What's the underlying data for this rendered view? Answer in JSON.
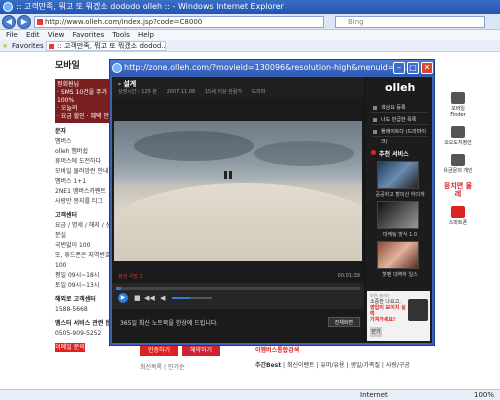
{
  "ie": {
    "title": ":: 고객만족, 뭐고 또 뭐겠소 dododo olleh :: - Windows Internet Explorer",
    "address": "http://www.olleh.com/index.jsp?code=C8000",
    "search_placeholder": "Bing",
    "menu": [
      "File",
      "Edit",
      "View",
      "Favorites",
      "Tools",
      "Help"
    ],
    "favorites_label": "Favorites",
    "tab_label": ":: 고객만족, 뭐고 또 뭐겠소 dodod...",
    "status_zone": "Internet",
    "status_zoom": "100%"
  },
  "page": {
    "section_title": "모바일",
    "sidebar_box": [
      "정회원님",
      "· SMS 10건을 주가 100%",
      "· 오늘의",
      "· 요금 할인 · 혜택 안내"
    ],
    "sidebar_links": [
      "문자",
      "멤버스",
      "olleh 멤버쉽",
      "휴머스에 도전하다",
      "모바일 물러앙런 안내",
      "멤버스 1+1",
      "2NE1 멤버스카펜트",
      "사랑만 몽지를 티그"
    ],
    "customer_center_title": "고객센터",
    "customer_center_items": [
      "요금 / 명세 / 해지 / 상담 / 분실",
      "국번없이 100",
      "또, 휴드폰은 지역번호 + 100",
      "평일 09시~18시",
      "토일 09시~13시"
    ],
    "phone_title": "해외로 고객센터",
    "phone_number": "1588-5668",
    "service_title": "멤스터 서비스 관련 문의",
    "service_number": "0505-909-5252",
    "inquiry_btn": "이메일 문의",
    "right_col": [
      "모바일 Finder",
      "오오도지정안",
      "유금문의 개인",
      "뭉치면 올레",
      "스마트폰"
    ],
    "bottom_btn1": "인증하기",
    "bottom_btn2": "해약하기",
    "bottom_search_label": "이멤버스통합검색",
    "bottom_links": [
      "주간Best",
      "최신이벤트",
      "유머/유용",
      "생일/가족질",
      "사랑/구공"
    ],
    "bottom_left": "최신목록 | 인기순"
  },
  "popup": {
    "title": "http://zone.olleh.com/?movieid=130096&resolution-high&menuid=1...",
    "video_title": "- 설계",
    "meta": [
      "상영시간 : 125 분",
      "2007.11.08",
      "15세 이상 관람가",
      "드라마"
    ],
    "caption": "정생 극장.1",
    "time": "00:01:39",
    "ticker": "365일 최신 노트북을 한상에 드립니다.",
    "fullscreen_btn": "전체화면",
    "progress_fraction": 0.02,
    "volume_fraction": 0.45
  },
  "side": {
    "brand": "olleh",
    "menu": [
      "색상요 등록",
      "나도 만급한 목록",
      "플레이트다 (드라마이크)"
    ],
    "rec_title": "추천 서비스",
    "thumbs": [
      "공공하고 할미산 하더게",
      "마케팅 방식 1.0",
      "핫팬 대역하 일스"
    ],
    "ad_small": "보연 서비스",
    "ad_text1": "소중한 나요고,",
    "ad_text2": "영업이 보이지 실력",
    "ad_text3": "가져가세요!",
    "ad_btn": "닫기"
  }
}
